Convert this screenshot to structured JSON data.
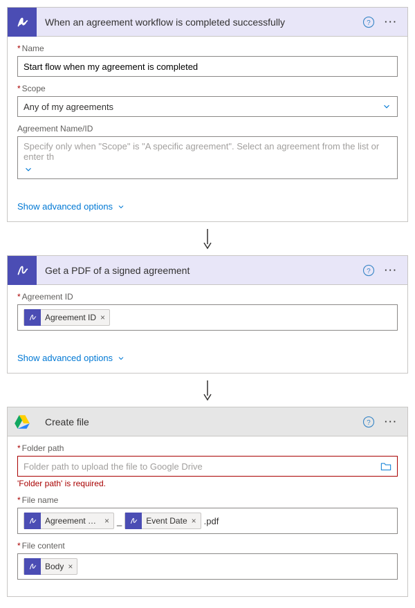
{
  "card1": {
    "title": "When an agreement workflow is completed successfully",
    "name_label": "Name",
    "name_value": "Start flow when my agreement is completed",
    "scope_label": "Scope",
    "scope_value": "Any of my agreements",
    "agreement_label": "Agreement Name/ID",
    "agreement_placeholder": "Specify only when \"Scope\" is \"A specific agreement\". Select an agreement from the list or enter th",
    "adv": "Show advanced options"
  },
  "card2": {
    "title": "Get a PDF of a signed agreement",
    "agreement_id_label": "Agreement ID",
    "token_agreement_id": "Agreement ID",
    "adv": "Show advanced options"
  },
  "card3": {
    "title": "Create file",
    "folder_label": "Folder path",
    "folder_placeholder": "Folder path to upload the file to Google Drive",
    "folder_error": "'Folder path' is required.",
    "filename_label": "File name",
    "token_agreement_name": "Agreement Na...",
    "token_event_date": "Event Date",
    "filename_suffix": ".pdf",
    "filename_sep": "_",
    "filecontent_label": "File content",
    "token_body": "Body"
  }
}
